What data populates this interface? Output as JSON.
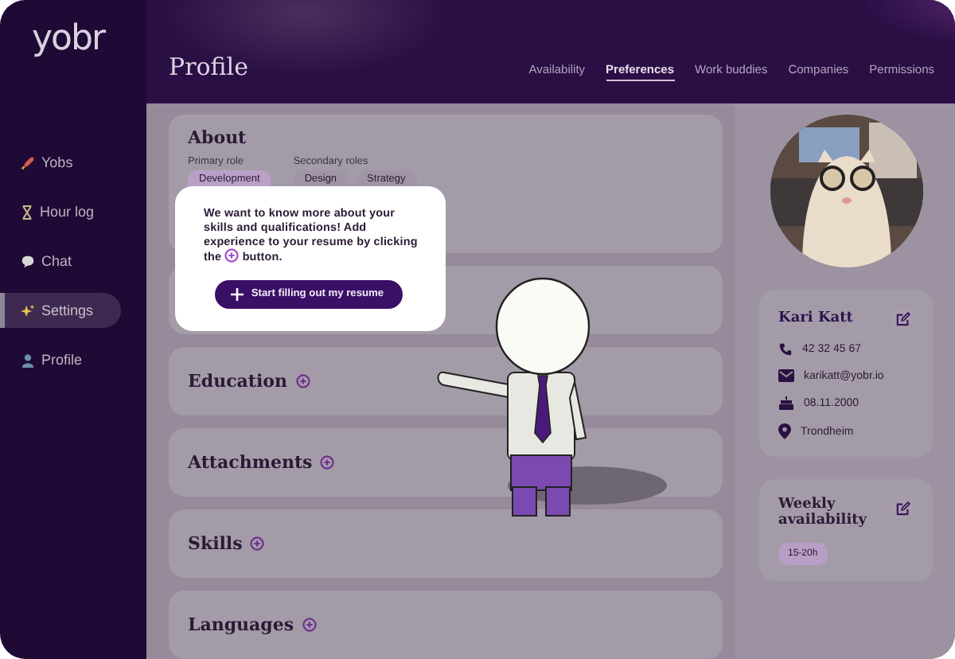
{
  "logo": "yobr",
  "sidebar": {
    "items": [
      {
        "label": "Yobs",
        "kind": "rocket",
        "selected": false
      },
      {
        "label": "Hour log",
        "kind": "hourglass",
        "selected": false
      },
      {
        "label": "Chat",
        "kind": "bubble",
        "selected": false
      },
      {
        "label": "Settings",
        "kind": "sparkle",
        "selected": true
      },
      {
        "label": "Profile",
        "kind": "person",
        "selected": false
      }
    ]
  },
  "header": {
    "title": "Profile",
    "tabs": [
      {
        "label": "Availability",
        "selected": false
      },
      {
        "label": "Preferences",
        "selected": true
      },
      {
        "label": "Work buddies",
        "selected": false
      },
      {
        "label": "Companies",
        "selected": false
      },
      {
        "label": "Permissions",
        "selected": false
      }
    ]
  },
  "about": {
    "title": "About",
    "groups": [
      {
        "label": "Primary role",
        "primary": true,
        "chips": [
          "Development"
        ]
      },
      {
        "label": "Secondary roles",
        "primary": false,
        "chips": [
          "Design",
          "Strategy"
        ]
      }
    ]
  },
  "sections": [
    {
      "title": "Education"
    },
    {
      "title": "Attachments"
    },
    {
      "title": "Skills"
    },
    {
      "title": "Languages"
    }
  ],
  "profile": {
    "name": "Kari Katt",
    "details": [
      {
        "kind": "phone",
        "text": "42 32 45 67"
      },
      {
        "kind": "mail",
        "text": "karikatt@yobr.io"
      },
      {
        "kind": "cake",
        "text": "08.11.2000"
      },
      {
        "kind": "pin",
        "text": "Trondheim"
      }
    ]
  },
  "availability": {
    "title": "Weekly availability",
    "chips": [
      "15-20h"
    ]
  },
  "popup": {
    "message": "We want to know more about your skills and qualifications! Add experience to your resume by clicking",
    "message_start": "the",
    "message_end": "button.",
    "button": "Start filling out my resume"
  }
}
